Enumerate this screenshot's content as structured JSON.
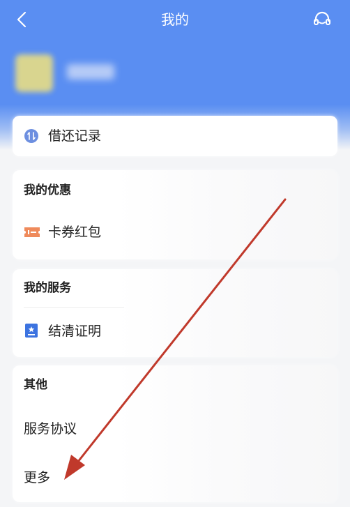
{
  "header": {
    "title": "我的"
  },
  "menu": {
    "borrow_records": "借还记录",
    "offers": {
      "section": "我的优惠",
      "coupons": "卡券红包"
    },
    "services": {
      "section": "我的服务",
      "settlement": "结清证明"
    },
    "other": {
      "section": "其他",
      "agreement": "服务协议",
      "more": "更多"
    }
  },
  "colors": {
    "brand": "#5a8ef2",
    "coupon_icon": "#ef8a5b",
    "annotation_arrow": "#c0392b"
  }
}
